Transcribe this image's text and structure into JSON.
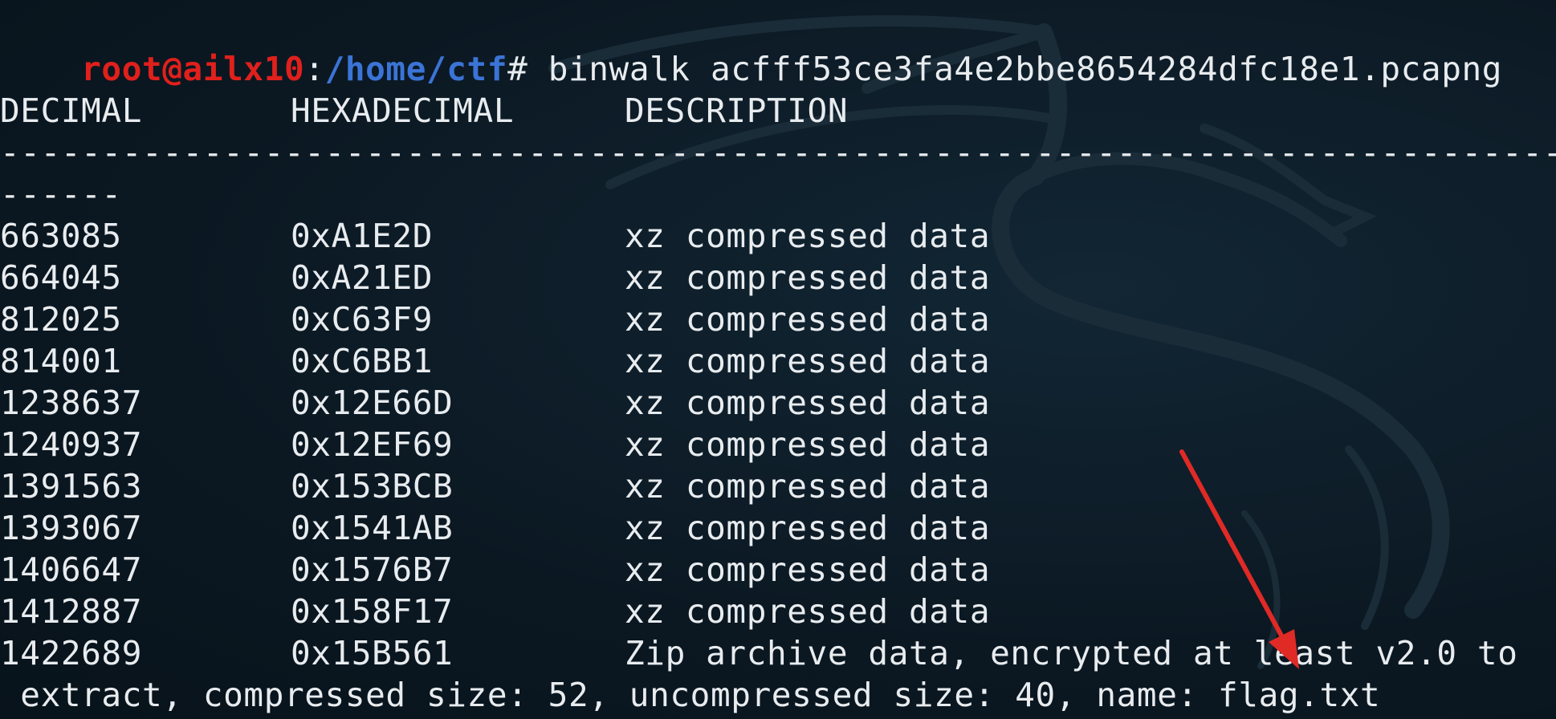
{
  "terminal": {
    "prompt_user_host": "root@ailx10",
    "prompt_colon": ":",
    "prompt_path": "/home/ctf",
    "prompt_symbol": "# ",
    "command": "binwalk acfff53ce3fa4e2bbe8654284dfc18e1.pcapng"
  },
  "table": {
    "headers": [
      "DECIMAL",
      "HEXADECIMAL",
      "DESCRIPTION"
    ],
    "separator_line1": "----------------------------------------------------------------------------------------",
    "separator_line2": "------",
    "rows": [
      {
        "decimal": "663085",
        "hex": "0xA1E2D",
        "desc": "xz compressed data"
      },
      {
        "decimal": "664045",
        "hex": "0xA21ED",
        "desc": "xz compressed data"
      },
      {
        "decimal": "812025",
        "hex": "0xC63F9",
        "desc": "xz compressed data"
      },
      {
        "decimal": "814001",
        "hex": "0xC6BB1",
        "desc": "xz compressed data"
      },
      {
        "decimal": "1238637",
        "hex": "0x12E66D",
        "desc": "xz compressed data"
      },
      {
        "decimal": "1240937",
        "hex": "0x12EF69",
        "desc": "xz compressed data"
      },
      {
        "decimal": "1391563",
        "hex": "0x153BCB",
        "desc": "xz compressed data"
      },
      {
        "decimal": "1393067",
        "hex": "0x1541AB",
        "desc": "xz compressed data"
      },
      {
        "decimal": "1406647",
        "hex": "0x1576B7",
        "desc": "xz compressed data"
      },
      {
        "decimal": "1412887",
        "hex": "0x158F17",
        "desc": "xz compressed data"
      },
      {
        "decimal": "1422689",
        "hex": "0x15B561",
        "desc": "Zip archive data, encrypted at least v2.0 to"
      }
    ],
    "wrap_line": " extract, compressed size: 52, uncompressed size: 40, name: flag.txt"
  },
  "colors": {
    "background": "#0c1a24",
    "text": "#e8ecef",
    "prompt_user": "#e0201c",
    "prompt_path": "#3b74d6",
    "annotation_arrow": "#e02a26"
  },
  "icons": {
    "background_logo": "kali-dragon-icon",
    "annotation": "red-arrow-icon"
  }
}
